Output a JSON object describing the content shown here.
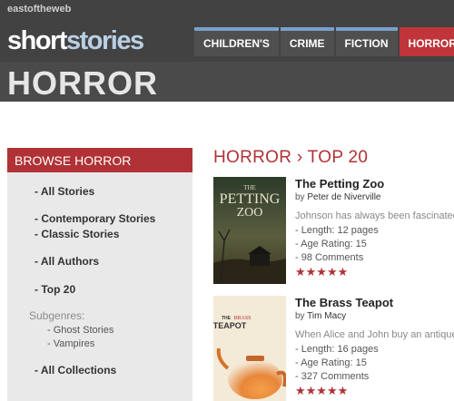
{
  "brand": {
    "site": "eastoftheweb",
    "logo_part1": "short",
    "logo_part2": "stories"
  },
  "page_title": "HORROR",
  "nav": [
    {
      "label": "CHILDREN'S",
      "active": false
    },
    {
      "label": "CRIME",
      "active": false
    },
    {
      "label": "FICTION",
      "active": false
    },
    {
      "label": "HORROR",
      "active": true
    }
  ],
  "sidebar": {
    "heading": "BROWSE HORROR",
    "links": [
      "- All Stories",
      "- Contemporary Stories",
      "- Classic Stories",
      "- All Authors",
      "- Top 20",
      "- All Collections"
    ],
    "subgenres_label": "Subgenres:",
    "subgenres": [
      "- Ghost Stories",
      "- Vampires"
    ]
  },
  "main": {
    "heading": "HORROR › TOP 20",
    "stories": [
      {
        "title": "The Petting Zoo",
        "by": "by",
        "author": "Peter de Niverville",
        "teaser": "Johnson has always been fascinated",
        "length": "- Length: 12 pages",
        "age": "- Age Rating: 15",
        "comments": "- 98 Comments",
        "stars": "★★★★★",
        "cover_text1": "PETTING",
        "cover_text2": "ZOO",
        "cover_text0": "THE"
      },
      {
        "title": "The Brass Teapot",
        "by": "by",
        "author": "Tim Macy",
        "teaser": "When Alice and John buy an antique",
        "length": "- Length: 16 pages",
        "age": "- Age Rating: 15",
        "comments": "- 327 Comments",
        "stars": "★★★★★",
        "cover_text0": "THE",
        "cover_text1": "BRASS",
        "cover_text2": "TEAPOT"
      }
    ]
  },
  "colors": {
    "accent": "#b03236",
    "nav_border": "#7aa0c9",
    "header_bg": "#4a4a4a"
  }
}
